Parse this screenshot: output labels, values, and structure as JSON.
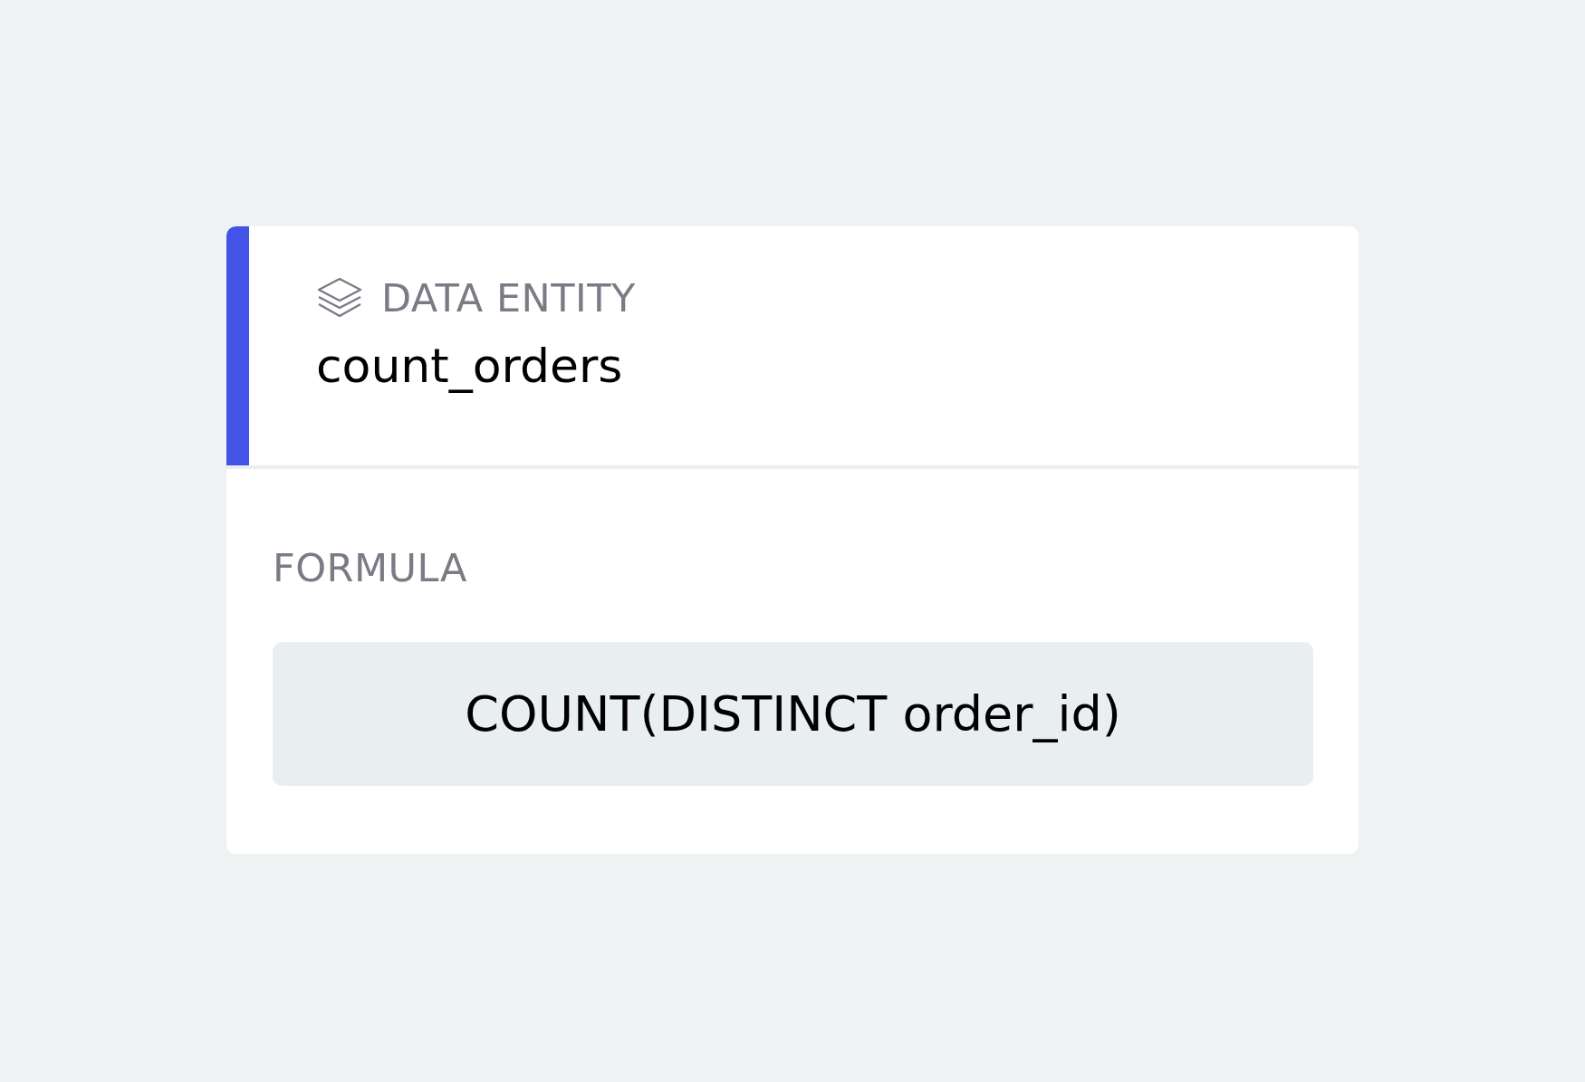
{
  "card": {
    "type_label": "DATA ENTITY",
    "name": "count_orders",
    "formula_label": "FORMULA",
    "formula": "COUNT(DISTINCT order_id)"
  }
}
